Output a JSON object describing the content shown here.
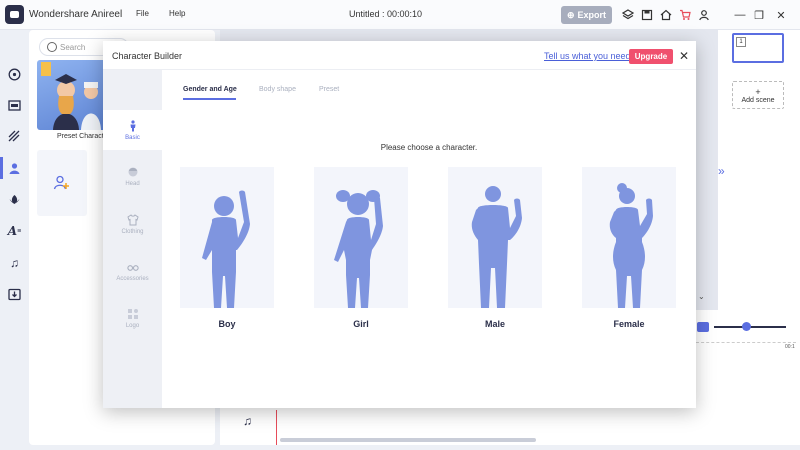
{
  "app": {
    "name": "Wondershare Anireel",
    "menu": [
      "File",
      "Help"
    ],
    "doc_title": "Untitled : 00:00:10",
    "export_label": "Export"
  },
  "library": {
    "search_placeholder": "Search",
    "preset_label": "Preset Characte"
  },
  "scenes": {
    "thumb_number": "1",
    "add_label": "Add scene"
  },
  "timeline": {
    "end_time": "00:1"
  },
  "modal": {
    "title": "Character Builder",
    "help_link": "Tell us what you need",
    "upgrade_label": "Upgrade",
    "categories": [
      {
        "label": "Basic",
        "icon": "person-icon",
        "active": true
      },
      {
        "label": "Head",
        "icon": "head-icon",
        "active": false
      },
      {
        "label": "Clothing",
        "icon": "shirt-icon",
        "active": false
      },
      {
        "label": "Accessories",
        "icon": "glasses-icon",
        "active": false
      },
      {
        "label": "Logo",
        "icon": "shapes-icon",
        "active": false
      }
    ],
    "tabs": [
      {
        "label": "Gender and Age",
        "active": true
      },
      {
        "label": "Body shape",
        "active": false
      },
      {
        "label": "Preset",
        "active": false
      }
    ],
    "prompt": "Please choose a character.",
    "characters": [
      {
        "label": "Boy"
      },
      {
        "label": "Girl"
      },
      {
        "label": "Male"
      },
      {
        "label": "Female"
      }
    ]
  },
  "colors": {
    "accent": "#5b6ee1",
    "silhouette": "#7f95df",
    "upgrade": "#f0506e"
  }
}
